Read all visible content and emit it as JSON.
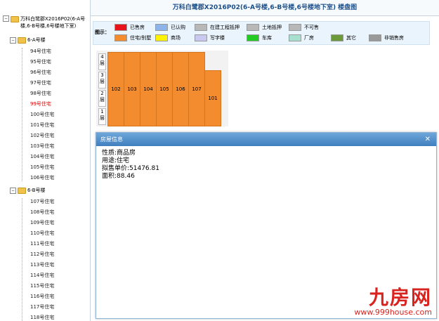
{
  "sidebar": {
    "root": "万科白鹭郡X2016P02(6-A号楼,6-B号楼,6号楼地下室)",
    "groups": [
      {
        "label": "6-A号楼",
        "items": [
          "94号住宅",
          "95号住宅",
          "96号住宅",
          "97号住宅",
          "98号住宅",
          "99号住宅",
          "100号住宅",
          "101号住宅",
          "102号住宅",
          "103号住宅",
          "104号住宅",
          "105号住宅",
          "106号住宅"
        ]
      },
      {
        "label": "6-B号楼",
        "items": [
          "107号住宅",
          "108号住宅",
          "109号住宅",
          "110号住宅",
          "111号住宅",
          "112号住宅",
          "113号住宅",
          "114号住宅",
          "115号住宅",
          "116号住宅",
          "117号住宅",
          "118号住宅"
        ]
      }
    ],
    "active_item": "99号住宅"
  },
  "header": {
    "title": "万科白鹭郡X2016P02(6-A号楼,6-B号楼,6号楼地下室) 楼盘图"
  },
  "legend": {
    "label": "图示：",
    "items": [
      {
        "label": "已售房",
        "color": "#e8141b"
      },
      {
        "label": "已认购",
        "color": "#8db4e8"
      },
      {
        "label": "在建工程抵押",
        "color": "#b8b8b8"
      },
      {
        "label": "土地抵押",
        "color": "#b8b8b8"
      },
      {
        "label": "不可售",
        "color": "#b8b8b8"
      },
      {
        "label": "住宅/别墅",
        "color": "#f28c2e"
      },
      {
        "label": "商场",
        "color": "#fff200"
      },
      {
        "label": "写字楼",
        "color": "#c8c8f0"
      },
      {
        "label": "车库",
        "color": "#22cc22"
      },
      {
        "label": "厂房",
        "color": "#a8e0cf"
      },
      {
        "label": "其它",
        "color": "#6b9a3a"
      },
      {
        "label": "非销售房",
        "color": "#999999"
      }
    ]
  },
  "building": {
    "floors": [
      "4\n层",
      "3\n层",
      "2\n层",
      "1\n层"
    ],
    "units": [
      "102",
      "103",
      "104",
      "105",
      "106",
      "107",
      "101"
    ]
  },
  "dialog": {
    "title": "房屋信息",
    "close": "✕",
    "lines": [
      "性质:商品房",
      "用途:住宅",
      "拟售单价:51476.81",
      "面积:88.46"
    ]
  },
  "watermark": {
    "brand": "九房网",
    "url": "www.999house.com"
  }
}
